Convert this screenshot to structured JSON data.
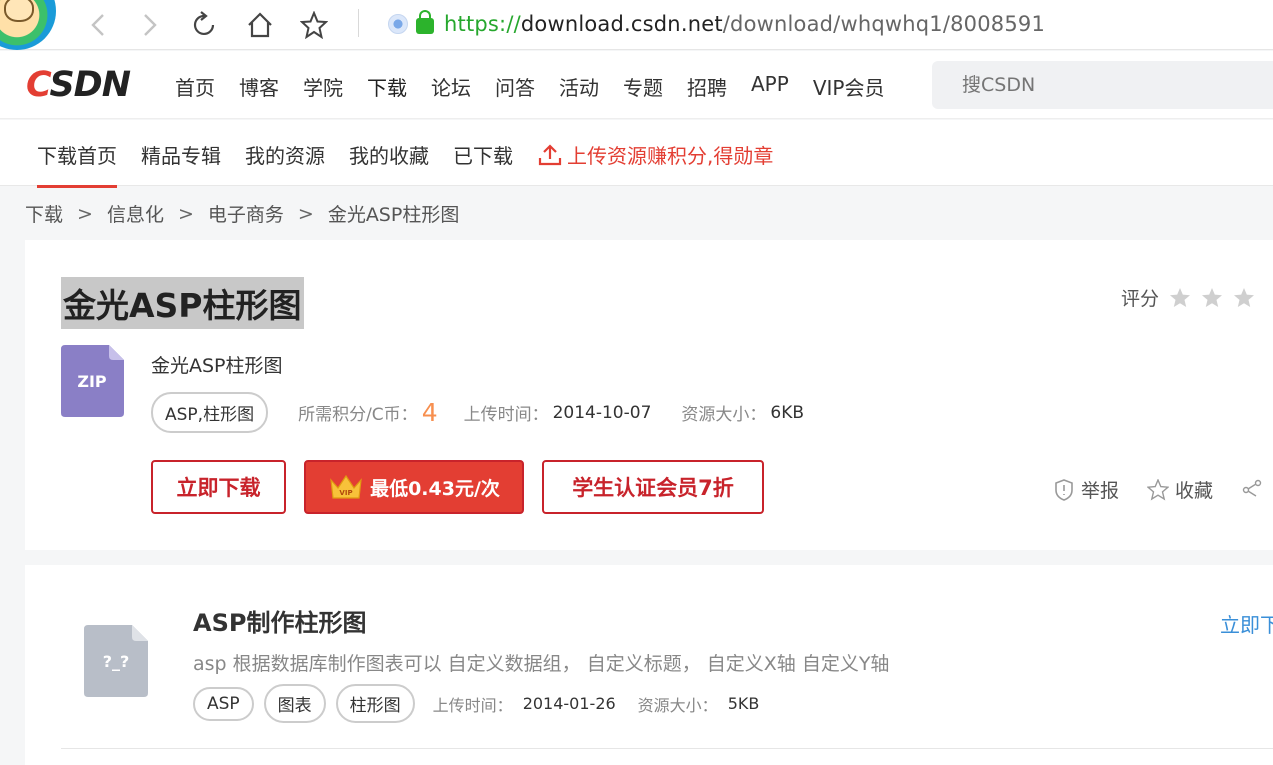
{
  "browser": {
    "url_scheme": "https://",
    "url_host": "download.csdn.net",
    "url_path": "/download/whqwhq1/8008591"
  },
  "header": {
    "logo": "CSDN",
    "nav": [
      "首页",
      "博客",
      "学院",
      "下载",
      "论坛",
      "问答",
      "活动",
      "专题",
      "招聘",
      "APP",
      "VIP会员"
    ],
    "active_nav": "下载",
    "search_placeholder": "搜CSDN"
  },
  "sub_nav": {
    "items": [
      "下载首页",
      "精品专辑",
      "我的资源",
      "我的收藏",
      "已下载"
    ],
    "upload": "上传资源赚积分,得勋章"
  },
  "breadcrumb": [
    "下载",
    "信息化",
    "电子商务",
    "金光ASP柱形图"
  ],
  "breadcrumb_sep": ">",
  "resource": {
    "title": "金光ASP柱形图",
    "file_type": "ZIP",
    "file_name": "金光ASP柱形图",
    "tag": "ASP,柱形图",
    "points_label": "所需积分/C币：",
    "points": "4",
    "upload_time_label": "上传时间：",
    "upload_time": "2014-10-07",
    "size_label": "资源大小：",
    "size": "6KB",
    "rating_label": "评分",
    "download_btn": "立即下载",
    "vip_btn": "最低0.43元/次",
    "vip_badge": "VIP",
    "student_btn": "学生认证会员7折",
    "report": "举报",
    "favorite": "收藏"
  },
  "related": {
    "icon_text": "?_?",
    "title": "ASP制作柱形图",
    "desc": "asp 根据数据库制作图表可以 自定义数据组， 自定义标题， 自定义X轴 自定义Y轴",
    "tags": [
      "ASP",
      "图表",
      "柱形图"
    ],
    "upload_time_label": "上传时间：",
    "upload_time": "2014-01-26",
    "size_label": "资源大小：",
    "size": "5KB",
    "download": "立即下"
  },
  "colors": {
    "brand_red": "#e33e33",
    "points_orange": "#f78f4f",
    "link_blue": "#3a8fd8",
    "url_green": "#26a72d",
    "zip_purple": "#8a7fc6",
    "unknown_gray": "#b8bec8"
  }
}
